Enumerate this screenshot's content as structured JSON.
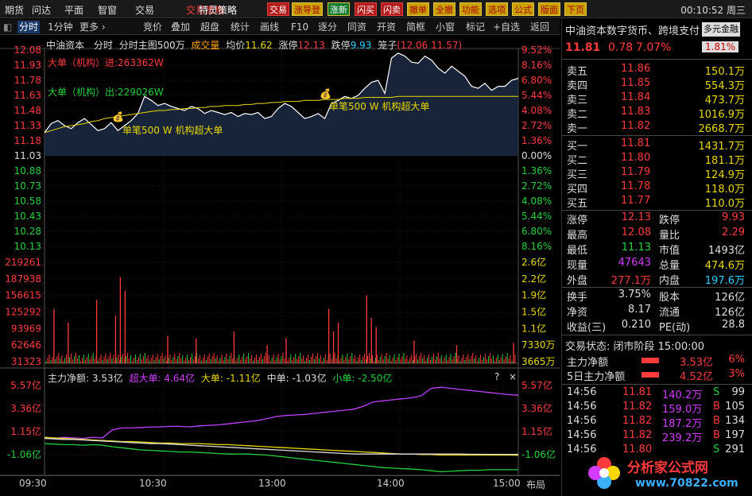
{
  "topmenu": {
    "items": [
      "期货",
      "问达",
      "平面",
      "智窗",
      "交易"
    ],
    "overlay_text": "特灵策略",
    "overlay_title": "交易策略",
    "buttons": [
      "交易",
      "涨导登",
      "涨新",
      "闪买",
      "闪卖",
      "撤单",
      "全撤",
      "功能",
      "选项",
      "公式",
      "版面",
      "下页"
    ],
    "clock": "00:10:52 周三"
  },
  "toolbar": {
    "left_tabs": [
      "分时",
      "1分钟",
      "更多 ›"
    ],
    "buttons": [
      "竞价",
      "叠加",
      "超盘",
      "统计",
      "画线",
      "F10",
      "逐分",
      "同资",
      "开资",
      "简框",
      "小窗",
      "标记",
      "+自选",
      "返回"
    ]
  },
  "chart_header": {
    "name": "中油资本",
    "mode": "分时",
    "sub": "分时主图500万",
    "vol_label": "成交量",
    "avg_label": "均价",
    "avg_value": "11.62",
    "limit_up_label": "涨停",
    "limit_up_value": "12.13",
    "limit_down_label": "跌停",
    "limit_down_value": "9.93",
    "box_label": "笼子",
    "box_value": "(12.06 11.57)"
  },
  "price_axis": {
    "left": [
      "12.08",
      "11.93",
      "11.78",
      "11.63",
      "11.48",
      "11.33",
      "11.18",
      "11.03",
      "10.88",
      "10.73",
      "10.58",
      "10.43",
      "10.28",
      "10.13"
    ],
    "right": [
      "9.52%",
      "8.16%",
      "6.80%",
      "5.44%",
      "4.08%",
      "2.72%",
      "1.36%",
      "0.00%",
      "1.36%",
      "2.72%",
      "4.08%",
      "5.44%",
      "6.80%",
      "8.16%"
    ]
  },
  "volume_axis": {
    "left": [
      "219261",
      "187938",
      "156615",
      "125292",
      "93969",
      "62646",
      "31323"
    ],
    "right": [
      "2.6亿",
      "2.2亿",
      "1.9亿",
      "1.5亿",
      "1.1亿",
      "7330万",
      "3665万"
    ]
  },
  "flow_axis": {
    "left": [
      "5.57亿",
      "3.36亿",
      "1.15亿",
      "-1.06亿"
    ],
    "right": [
      "5.57亿",
      "3.36亿",
      "1.15亿",
      "-1.06亿"
    ]
  },
  "annotations": {
    "big_in": "大单（机构）进:263362W",
    "big_out": "大单（机构）出:229026W",
    "note1": "单笔500 W 机构超大单",
    "note2": "单笔500 W 机构超大单"
  },
  "flow_header": {
    "main_label": "主力净额:",
    "main_value": "3.53亿",
    "xl_label": "超大单:",
    "xl_value": "4.64亿",
    "l_label": "大单:",
    "l_value": "-1.11亿",
    "m_label": "中单:",
    "m_value": "-1.03亿",
    "s_label": "小单:",
    "s_value": "-2.50亿",
    "q": "?",
    "x": "×"
  },
  "time_axis": {
    "labels": [
      "09:30",
      "10:30",
      "13:00",
      "14:00",
      "15:00"
    ],
    "layout_btn": "布局"
  },
  "right_panel": {
    "title": "中油资本数字货币、跨境支付",
    "title_tag": "多元金融",
    "price": "11.81",
    "change": "0.78",
    "pct": "7.07%",
    "badge": "1.81%",
    "asks": [
      {
        "label": "卖五",
        "price": "11.86",
        "vol": "150.1万"
      },
      {
        "label": "卖四",
        "price": "11.85",
        "vol": "554.3万"
      },
      {
        "label": "卖三",
        "price": "11.84",
        "vol": "473.7万"
      },
      {
        "label": "卖二",
        "price": "11.83",
        "vol": "1016.9万"
      },
      {
        "label": "卖一",
        "price": "11.82",
        "vol": "2668.7万"
      }
    ],
    "bids": [
      {
        "label": "买一",
        "price": "11.81",
        "vol": "1431.7万"
      },
      {
        "label": "买二",
        "price": "11.80",
        "vol": "181.1万"
      },
      {
        "label": "买三",
        "price": "11.79",
        "vol": "124.9万"
      },
      {
        "label": "买四",
        "price": "11.78",
        "vol": "118.0万"
      },
      {
        "label": "买五",
        "price": "11.77",
        "vol": "110.0万"
      }
    ],
    "stats": [
      {
        "l1": "涨停",
        "v1": "12.13",
        "l2": "跌停",
        "v2": "9.93"
      },
      {
        "l1": "最高",
        "v1": "12.08",
        "l2": "量比",
        "v2": "2.29"
      },
      {
        "l1": "最低",
        "v1": "11.13",
        "l2": "市值",
        "v2": "1493亿"
      },
      {
        "l1": "现量",
        "v1": "47643",
        "l2": "总量",
        "v2": "474.6万"
      },
      {
        "l1": "外盘",
        "v1": "277.1万",
        "l2": "内盘",
        "v2": "197.6万"
      }
    ],
    "stats2": [
      {
        "l1": "换手",
        "v1": "3.75%",
        "l2": "股本",
        "v2": "126亿"
      },
      {
        "l1": "净资",
        "v1": "8.17",
        "l2": "流通",
        "v2": "126亿"
      },
      {
        "l1": "收益(三)",
        "v1": "0.210",
        "l2": "PE(动)",
        "v2": "28.8"
      }
    ],
    "status": "交易状态: 闭市阶段 15:00:00",
    "flow": [
      {
        "label": "主力净额",
        "value": "3.53亿",
        "pct": "6%"
      },
      {
        "label": "5日主力净额",
        "value": "4.52亿",
        "pct": "3%"
      }
    ],
    "ticks": [
      {
        "t": "14:56",
        "p": "11.81",
        "v": "140.2万",
        "d": "S",
        "n": "99"
      },
      {
        "t": "14:56",
        "p": "11.82",
        "v": "159.0万",
        "d": "B",
        "n": "105"
      },
      {
        "t": "14:56",
        "p": "11.82",
        "v": "187.2万",
        "d": "B",
        "n": "134"
      },
      {
        "t": "14:56",
        "p": "11.82",
        "v": "239.2万",
        "d": "B",
        "n": "197"
      },
      {
        "t": "14:56",
        "p": "11.80",
        "v": "",
        "d": "S",
        "n": "291"
      }
    ],
    "watermark": "分析家公式网",
    "watermark_url": "www.70822.com"
  },
  "chart_data": {
    "type": "line",
    "x_range": [
      "09:30",
      "15:00"
    ],
    "price_ylim": [
      10.13,
      12.08
    ],
    "prev_close": 11.03,
    "price_series": [
      11.26,
      11.35,
      11.38,
      11.33,
      11.3,
      11.36,
      11.4,
      11.34,
      11.28,
      11.3,
      11.36,
      11.28,
      11.33,
      11.38,
      11.45,
      11.62,
      11.58,
      11.53,
      11.55,
      11.52,
      11.5,
      11.48,
      11.52,
      11.5,
      11.45,
      11.48,
      11.46,
      11.44,
      11.46,
      11.42,
      11.45,
      11.44,
      11.46,
      11.4,
      11.42,
      11.5,
      11.55,
      11.52,
      11.46,
      11.4,
      11.42,
      11.45,
      11.4,
      11.55,
      11.58,
      11.62,
      11.6,
      11.63,
      11.7,
      11.76,
      11.78,
      11.65,
      12.0,
      12.05,
      12.02,
      11.96,
      11.95,
      12.02,
      11.98,
      11.9,
      11.85,
      11.92,
      11.87,
      11.82,
      11.72,
      11.7,
      11.75,
      11.68,
      11.72,
      11.72,
      11.78,
      11.8
    ],
    "avg_series": [
      11.26,
      11.28,
      11.3,
      11.32,
      11.33,
      11.34,
      11.35,
      11.37,
      11.38,
      11.4,
      11.41,
      11.42,
      11.43,
      11.44,
      11.45,
      11.46,
      11.47,
      11.48,
      11.48,
      11.49,
      11.49,
      11.5,
      11.5,
      11.51,
      11.51,
      11.52,
      11.52,
      11.53,
      11.53,
      11.53,
      11.54,
      11.54,
      11.55,
      11.55,
      11.56,
      11.56,
      11.57,
      11.57,
      11.57,
      11.58,
      11.58,
      11.58,
      11.59,
      11.59,
      11.59,
      11.6,
      11.6,
      11.6,
      11.61,
      11.61,
      11.61,
      11.61,
      11.61,
      11.62,
      11.62,
      11.62,
      11.62,
      11.62,
      11.62,
      11.62,
      11.62,
      11.62,
      11.62,
      11.62,
      11.62,
      11.62,
      11.62,
      11.62,
      11.62,
      11.62,
      11.62,
      11.62
    ],
    "volume_ylim": [
      0,
      219261
    ],
    "volume_peaks": [
      {
        "x": 0.02,
        "v": 120000
      },
      {
        "x": 0.05,
        "v": 90000
      },
      {
        "x": 0.11,
        "v": 140000
      },
      {
        "x": 0.15,
        "v": 105000
      },
      {
        "x": 0.16,
        "v": 190000
      },
      {
        "x": 0.17,
        "v": 160000
      },
      {
        "x": 0.26,
        "v": 60000
      },
      {
        "x": 0.32,
        "v": 55000
      },
      {
        "x": 0.4,
        "v": 70000
      },
      {
        "x": 0.47,
        "v": 40000
      },
      {
        "x": 0.51,
        "v": 55000
      },
      {
        "x": 0.6,
        "v": 120000
      },
      {
        "x": 0.61,
        "v": 70000
      },
      {
        "x": 0.62,
        "v": 90000
      },
      {
        "x": 0.68,
        "v": 150000
      },
      {
        "x": 0.69,
        "v": 100000
      },
      {
        "x": 0.7,
        "v": 80000
      },
      {
        "x": 0.78,
        "v": 50000
      },
      {
        "x": 0.87,
        "v": 40000
      },
      {
        "x": 0.99,
        "v": 45000
      }
    ],
    "flow_ylim": [
      -1.06,
      5.57
    ],
    "flow_series": [
      {
        "name": "超大单",
        "color": "#c040ff",
        "values": [
          0.5,
          0.5,
          0.6,
          0.55,
          0.5,
          0.6,
          0.55,
          1.3,
          1.5,
          1.5,
          1.55,
          1.6,
          1.6,
          1.65,
          1.65,
          1.6,
          1.7,
          1.75,
          1.8,
          1.9,
          2.0,
          2.1,
          2.2,
          2.4,
          2.6,
          2.7,
          2.75,
          2.8,
          2.9,
          3.0,
          3.1,
          3.2,
          3.3,
          3.6,
          4.0,
          4.1,
          4.2,
          4.3,
          4.4,
          4.6,
          5.3,
          5.4,
          5.3,
          5.2,
          5.1,
          5.0,
          4.9,
          4.8,
          4.7,
          4.64
        ]
      },
      {
        "name": "小单",
        "color": "#21d23b",
        "values": [
          0.0,
          -0.05,
          -0.1,
          -0.1,
          -0.15,
          -0.1,
          -0.15,
          -0.3,
          -0.4,
          -0.5,
          -0.6,
          -0.65,
          -0.7,
          -0.75,
          -0.8,
          -0.8,
          -0.85,
          -0.9,
          -0.95,
          -1.0,
          -1.0,
          -1.0,
          -1.05,
          -1.1,
          -1.2,
          -1.3,
          -1.4,
          -1.5,
          -1.6,
          -1.7,
          -1.8,
          -1.9,
          -2.0,
          -2.1,
          -2.2,
          -2.3,
          -2.35,
          -2.4,
          -2.45,
          -2.5,
          -2.6,
          -2.7,
          -2.65,
          -2.6,
          -2.55,
          -2.55,
          -2.5,
          -2.5,
          -2.5,
          -2.5
        ]
      },
      {
        "name": "大单",
        "color": "#e8d800",
        "values": [
          0.6,
          0.55,
          0.5,
          0.45,
          0.4,
          0.35,
          0.3,
          0.25,
          0.2,
          0.2,
          0.15,
          0.1,
          0.05,
          0.05,
          0.0,
          0.0,
          0.0,
          -0.05,
          -0.1,
          -0.1,
          -0.15,
          -0.2,
          -0.25,
          -0.3,
          -0.35,
          -0.4,
          -0.45,
          -0.5,
          -0.55,
          -0.6,
          -0.65,
          -0.7,
          -0.75,
          -0.8,
          -0.85,
          -0.9,
          -0.95,
          -1.0,
          -1.0,
          -1.05,
          -1.05,
          -1.1,
          -1.1,
          -1.1,
          -1.1,
          -1.1,
          -1.1,
          -1.1,
          -1.1,
          -1.11
        ]
      },
      {
        "name": "中单",
        "color": "#dddddd",
        "values": [
          0.5,
          0.45,
          0.4,
          0.4,
          0.35,
          0.3,
          0.25,
          0.2,
          0.15,
          0.1,
          0.05,
          0.0,
          0.0,
          -0.05,
          -0.1,
          -0.15,
          -0.2,
          -0.25,
          -0.3,
          -0.35,
          -0.4,
          -0.45,
          -0.5,
          -0.55,
          -0.6,
          -0.65,
          -0.7,
          -0.75,
          -0.8,
          -0.85,
          -0.9,
          -0.95,
          -1.0,
          -1.0,
          -1.0,
          -1.0,
          -1.0,
          -1.0,
          -1.0,
          -1.0,
          -1.0,
          -1.0,
          -1.0,
          -1.0,
          -1.02,
          -1.02,
          -1.03,
          -1.03,
          -1.03,
          -1.03
        ]
      }
    ]
  }
}
